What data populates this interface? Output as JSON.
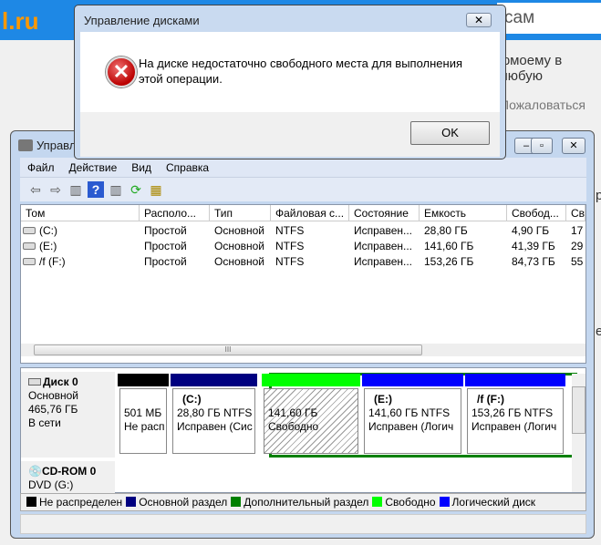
{
  "background": {
    "logo": "l.ru",
    "search_text": "сам",
    "text1": "юмоему в любую",
    "text2": "Пожаловаться",
    "text3": "р",
    "text4": "е"
  },
  "dialog": {
    "title": "Управление дисками",
    "message": "На диске недостаточно свободного места для выполнения этой операции.",
    "ok": "OK",
    "icon": "error-icon"
  },
  "window": {
    "title": "Управление дисками",
    "menu": [
      "Файл",
      "Действие",
      "Вид",
      "Справка"
    ],
    "columns": [
      "Том",
      "Располо...",
      "Тип",
      "Файловая с...",
      "Состояние",
      "Емкость",
      "Свобод...",
      "Св"
    ],
    "rows": [
      [
        "(C:)",
        "Простой",
        "Основной",
        "NTFS",
        "Исправен...",
        "28,80 ГБ",
        "4,90 ГБ",
        "17"
      ],
      [
        "(E:)",
        "Простой",
        "Основной",
        "NTFS",
        "Исправен...",
        "141,60 ГБ",
        "41,39 ГБ",
        "29"
      ],
      [
        "/f (F:)",
        "Простой",
        "Основной",
        "NTFS",
        "Исправен...",
        "153,26 ГБ",
        "84,73 ГБ",
        "55"
      ]
    ],
    "disk0": {
      "name": "Диск 0",
      "type": "Основной",
      "size": "465,76 ГБ",
      "status": "В сети",
      "partitions": [
        {
          "title": "",
          "size": "501 МБ",
          "state": "Не расп",
          "color": "#000000"
        },
        {
          "title": "(C:)",
          "size": "28,80 ГБ NTFS",
          "state": "Исправен (Сис",
          "color": "#000080"
        },
        {
          "title": "",
          "size": "141,60 ГБ",
          "state": "Свободно",
          "color": "#00ff00"
        },
        {
          "title": "(E:)",
          "size": "141,60 ГБ NTFS",
          "state": "Исправен (Логич",
          "color": "#0000ff"
        },
        {
          "title": "/f  (F:)",
          "size": "153,26 ГБ NTFS",
          "state": "Исправен (Логич",
          "color": "#0000ff"
        }
      ]
    },
    "cdrom": {
      "name": "CD-ROM 0",
      "type": "DVD (G:)"
    },
    "legend": [
      {
        "label": "Не распределен",
        "color": "#000000"
      },
      {
        "label": "Основной раздел",
        "color": "#000080"
      },
      {
        "label": "Дополнительный раздел",
        "color": "#008000"
      },
      {
        "label": "Свободно",
        "color": "#00ff00"
      },
      {
        "label": "Логический диск",
        "color": "#0000ff"
      }
    ]
  }
}
